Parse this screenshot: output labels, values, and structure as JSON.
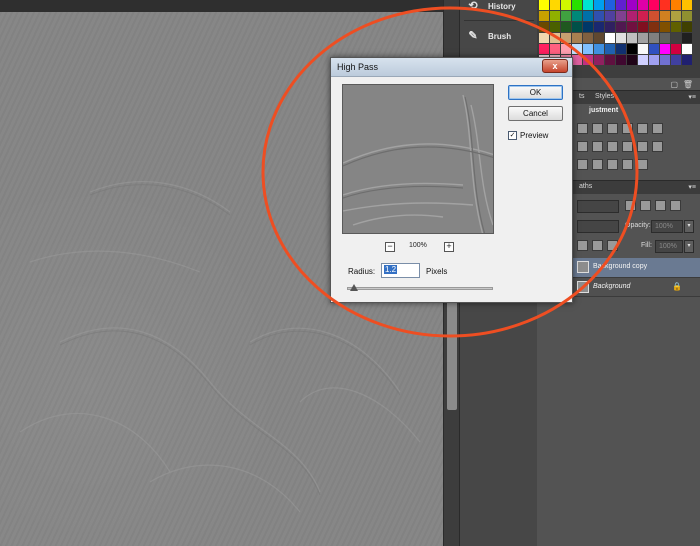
{
  "dock": {
    "items": [
      {
        "label": "History",
        "icon": "history-icon"
      },
      {
        "label": "Brush",
        "icon": "brush-icon"
      }
    ]
  },
  "swatches": {
    "rows": [
      [
        "#ffff00",
        "#ffd800",
        "#d0f700",
        "#28e000",
        "#00e4d0",
        "#00a0f0",
        "#2060e0",
        "#6020d0",
        "#a000c8",
        "#e000a8",
        "#ff0060",
        "#ff3020",
        "#ff8000",
        "#ffc000"
      ],
      [
        "#c8a000",
        "#90b000",
        "#40a040",
        "#008878",
        "#0070a8",
        "#3050b0",
        "#5040a0",
        "#804090",
        "#b02070",
        "#d02050",
        "#d05030",
        "#d08020",
        "#b0a040",
        "#909030"
      ],
      [
        "#6a4a00",
        "#4a6000",
        "#205820",
        "#005048",
        "#003868",
        "#1a2870",
        "#302060",
        "#501850",
        "#701040",
        "#801020",
        "#803010",
        "#805000",
        "#606000",
        "#404000"
      ],
      [
        "#f0d8b0",
        "#e0c090",
        "#c8a070",
        "#a88050",
        "#806040",
        "#604830",
        "#ffffff",
        "#e0e0e0",
        "#c0c0c0",
        "#a0a0a0",
        "#808080",
        "#606060",
        "#404040",
        "#202020"
      ],
      [
        "#ff2060",
        "#ff6080",
        "#ffa0b0",
        "#c0e0ff",
        "#80c0ff",
        "#4090e0",
        "#2060b0",
        "#103070",
        "#000000",
        "#f8f8f8",
        "#3050c0",
        "#ff00ff",
        "#d00040",
        "#ffffff"
      ],
      [
        "#ffe0e8",
        "#ffc0d0",
        "#ff90b0",
        "#e060a0",
        "#c03080",
        "#902060",
        "#601040",
        "#400830",
        "#200418",
        "#d0d0ff",
        "#a0a0f0",
        "#7070d0",
        "#4040a0",
        "#202070"
      ]
    ]
  },
  "panel_tabs": {
    "adjustments_visible": "ts",
    "styles": "Styles",
    "adjustments_title": "justment",
    "paths": "aths"
  },
  "layers": {
    "opacity_label": "Opacity:",
    "opacity_value": "100%",
    "fill_label": "Fill:",
    "fill_value": "100%",
    "rows": [
      {
        "name": "Background copy",
        "selected": true
      },
      {
        "name": "Background",
        "selected": false,
        "locked": true
      }
    ]
  },
  "dialog": {
    "title": "High Pass",
    "close": "x",
    "ok": "OK",
    "cancel": "Cancel",
    "preview_label": "Preview",
    "preview_checked": true,
    "zoom_minus": "−",
    "zoom_level": "100%",
    "zoom_plus": "+",
    "radius_label": "Radius:",
    "radius_value": "1.2",
    "unit": "Pixels",
    "slider_fraction": 0.05
  },
  "colors": {
    "annotation": "#ee4e22",
    "selected_layer": "#6a7a92",
    "canvas": "#858585"
  }
}
